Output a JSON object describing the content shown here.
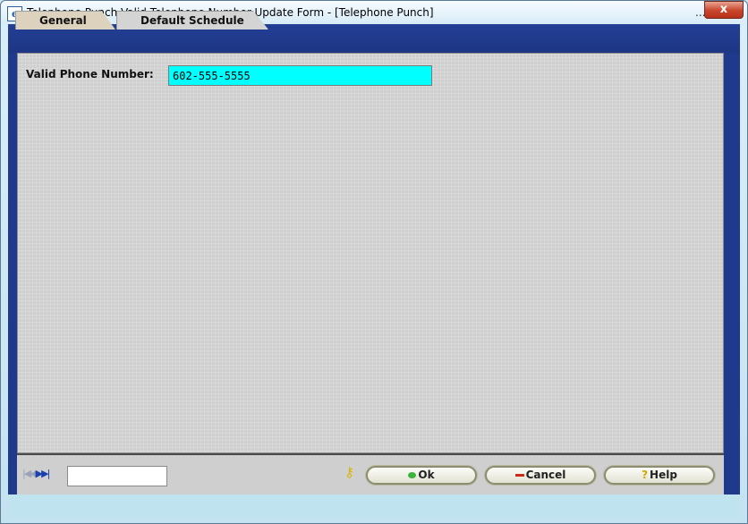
{
  "window": {
    "title": "Telephone Punch Valid Telephone Number Update Form - [Telephone Punch]",
    "ellipsis": "...",
    "close_label": "x",
    "app_icon": "e"
  },
  "tabs": [
    {
      "label": "General",
      "active": true
    },
    {
      "label": "Default Schedule",
      "active": false
    }
  ],
  "form": {
    "phone_label": "Valid Phone Number:",
    "phone_value": "602-555-5555"
  },
  "footer": {
    "nav_first": "|◀",
    "nav_prev": "◀",
    "nav_next": "▶",
    "nav_last": "▶|",
    "record_value": "",
    "ok_label": "Ok",
    "cancel_label": "Cancel",
    "help_label": "Help",
    "help_glyph": "?"
  },
  "colors": {
    "frame": "#1f3a8c",
    "field_bg": "#00ffff",
    "panel_bg": "#cfcfcf"
  }
}
